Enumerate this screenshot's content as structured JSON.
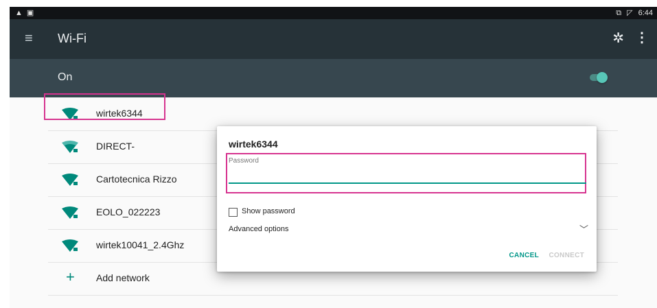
{
  "status_bar": {
    "left_icons": [
      "warning-icon",
      "image-icon"
    ],
    "right_icons": [
      "cast-icon",
      "no-signal-icon"
    ],
    "time": "6:44"
  },
  "app_bar": {
    "title": "Wi-Fi",
    "menu_icon": "menu-icon",
    "settings_icon": "gear-icon",
    "more_icon": "more-vert-icon"
  },
  "wifi_toggle": {
    "label": "On",
    "state": "on"
  },
  "networks": [
    {
      "name": "wirtek6344",
      "icon": "wifi-lock-icon"
    },
    {
      "name": "DIRECT-",
      "icon": "wifi-lock-icon"
    },
    {
      "name": "Cartotecnica Rizzo",
      "icon": "wifi-lock-icon"
    },
    {
      "name": "EOLO_022223",
      "icon": "wifi-lock-icon"
    },
    {
      "name": "wirtek10041_2.4Ghz",
      "icon": "wifi-lock-icon"
    }
  ],
  "add_network": {
    "label": "Add network",
    "icon": "plus-icon"
  },
  "dialog": {
    "title": "wirtek6344",
    "password_label": "Password",
    "password_value": "",
    "show_password_label": "Show password",
    "show_password_checked": false,
    "advanced_label": "Advanced options",
    "cancel_label": "CANCEL",
    "connect_label": "CONNECT"
  },
  "colors": {
    "accent": "#009688",
    "app_bar": "#263238",
    "toggle_bar": "#37474f",
    "highlight": "#d6338f"
  }
}
